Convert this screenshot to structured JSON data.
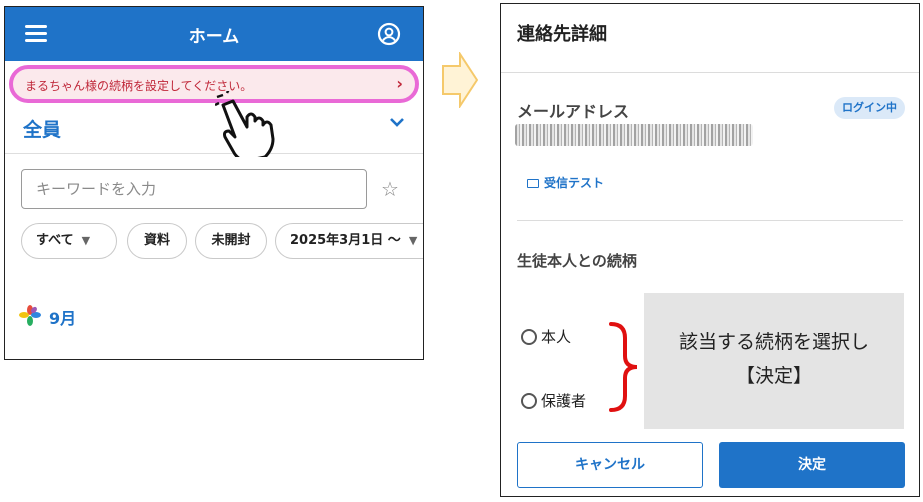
{
  "left_screen": {
    "header": {
      "title": "ホーム",
      "menu_icon": "menu-icon",
      "account_icon": "account-circle-icon"
    },
    "banner": {
      "text": "まるちゃん様の続柄を設定してください。",
      "chevron": "›",
      "highlight_color": "#e969d6"
    },
    "group": {
      "label": "全員",
      "chevron": "⌄"
    },
    "search": {
      "placeholder": "キーワードを入力",
      "value": ""
    },
    "star": "☆",
    "filters": [
      {
        "label": "すべて",
        "caret": "▼"
      },
      {
        "label": "資料"
      },
      {
        "label": "未開封"
      },
      {
        "label": "2025年3月1日 ～",
        "caret": "▼"
      }
    ],
    "month": {
      "label": "9月",
      "icon": "clover-icon"
    }
  },
  "right_screen": {
    "title": "連絡先詳細",
    "email": {
      "label": "メールアドレス",
      "badge": "ログイン中"
    },
    "test_button": "受信テスト",
    "relation": {
      "label": "生徒本人との続柄",
      "options": [
        "本人",
        "保護者"
      ]
    },
    "note": {
      "line1": "該当する続柄を選択し",
      "line2": "【決定】"
    },
    "buttons": {
      "cancel": "キャンセル",
      "decide": "決定"
    }
  },
  "colors": {
    "primary": "#1f73c8",
    "banner_bg": "#fbe9ec",
    "banner_text": "#c0283a",
    "arrow": "#f5c96b",
    "brace": "#e01010"
  }
}
